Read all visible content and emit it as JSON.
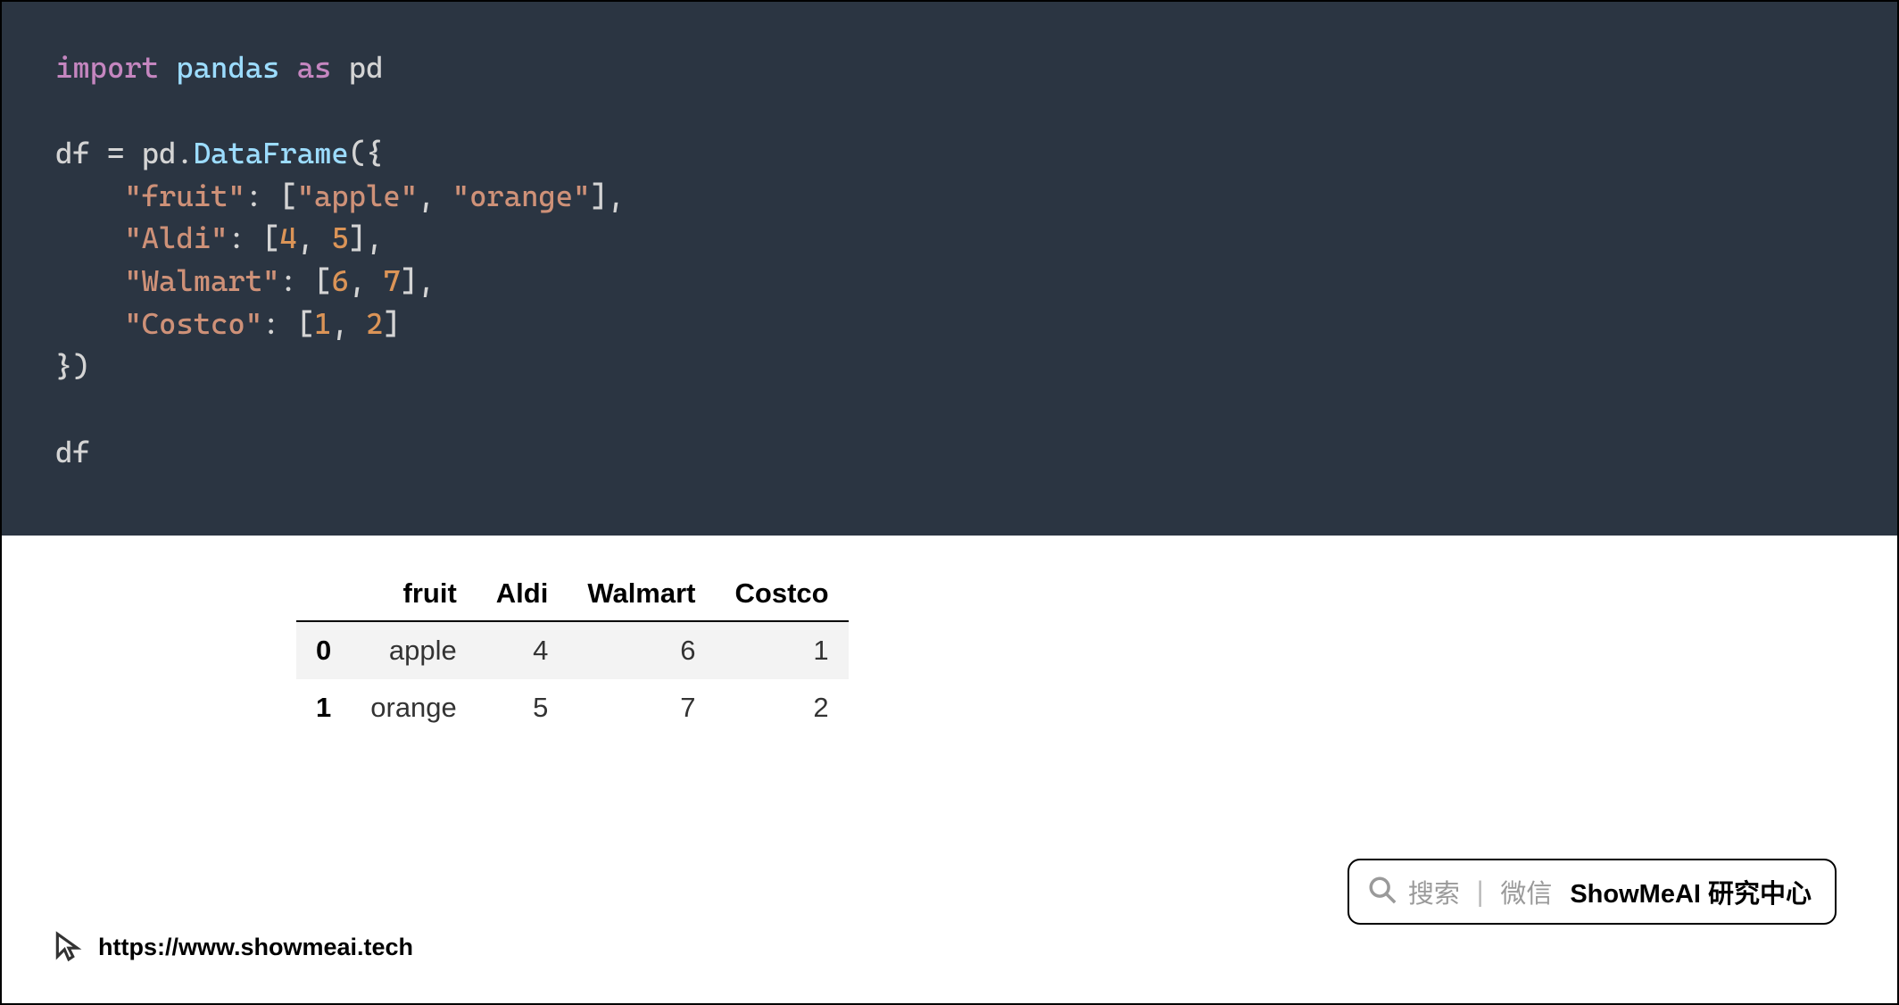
{
  "code": {
    "line1": {
      "import": "import",
      "module": "pandas",
      "as": "as",
      "alias": "pd"
    },
    "line3": {
      "var": "df",
      "eq": "=",
      "mod": "pd",
      "dot": ".",
      "cls": "DataFrame",
      "open": "({"
    },
    "line4": {
      "key": "\"fruit\"",
      "colon": ":",
      "v1": "\"apple\"",
      "v2": "\"orange\""
    },
    "line5": {
      "key": "\"Aldi\"",
      "v1": "4",
      "v2": "5"
    },
    "line6": {
      "key": "\"Walmart\"",
      "v1": "6",
      "v2": "7"
    },
    "line7": {
      "key": "\"Costco\"",
      "v1": "1",
      "v2": "2"
    },
    "line8": {
      "close": "})"
    },
    "line10": {
      "var": "df"
    }
  },
  "table": {
    "headers": [
      "fruit",
      "Aldi",
      "Walmart",
      "Costco"
    ],
    "rows": [
      {
        "idx": "0",
        "fruit": "apple",
        "Aldi": "4",
        "Walmart": "6",
        "Costco": "1"
      },
      {
        "idx": "1",
        "fruit": "orange",
        "Aldi": "5",
        "Walmart": "7",
        "Costco": "2"
      }
    ]
  },
  "footer": {
    "url": "https://www.showmeai.tech"
  },
  "searchbox": {
    "search": "搜索",
    "wechat": "微信",
    "brand": "ShowMeAI 研究中心"
  }
}
